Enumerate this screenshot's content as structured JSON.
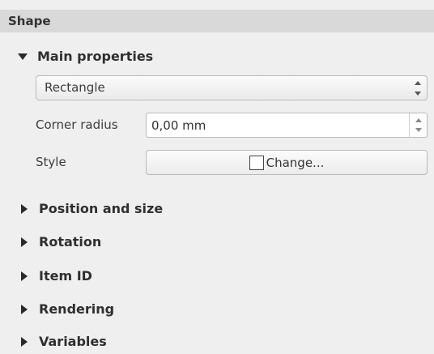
{
  "panel": {
    "title": "Shape"
  },
  "main_properties": {
    "title": "Main properties",
    "shape_select": {
      "value": "Rectangle"
    },
    "corner_radius": {
      "label": "Corner radius",
      "value": "0,00 mm"
    },
    "style": {
      "label": "Style",
      "button_label": "Change..."
    }
  },
  "groups": [
    {
      "label": "Position and size"
    },
    {
      "label": "Rotation"
    },
    {
      "label": "Item ID"
    },
    {
      "label": "Rendering"
    },
    {
      "label": "Variables"
    }
  ],
  "icons": {
    "expanded": "triangle-down-icon",
    "collapsed": "triangle-right-icon"
  }
}
